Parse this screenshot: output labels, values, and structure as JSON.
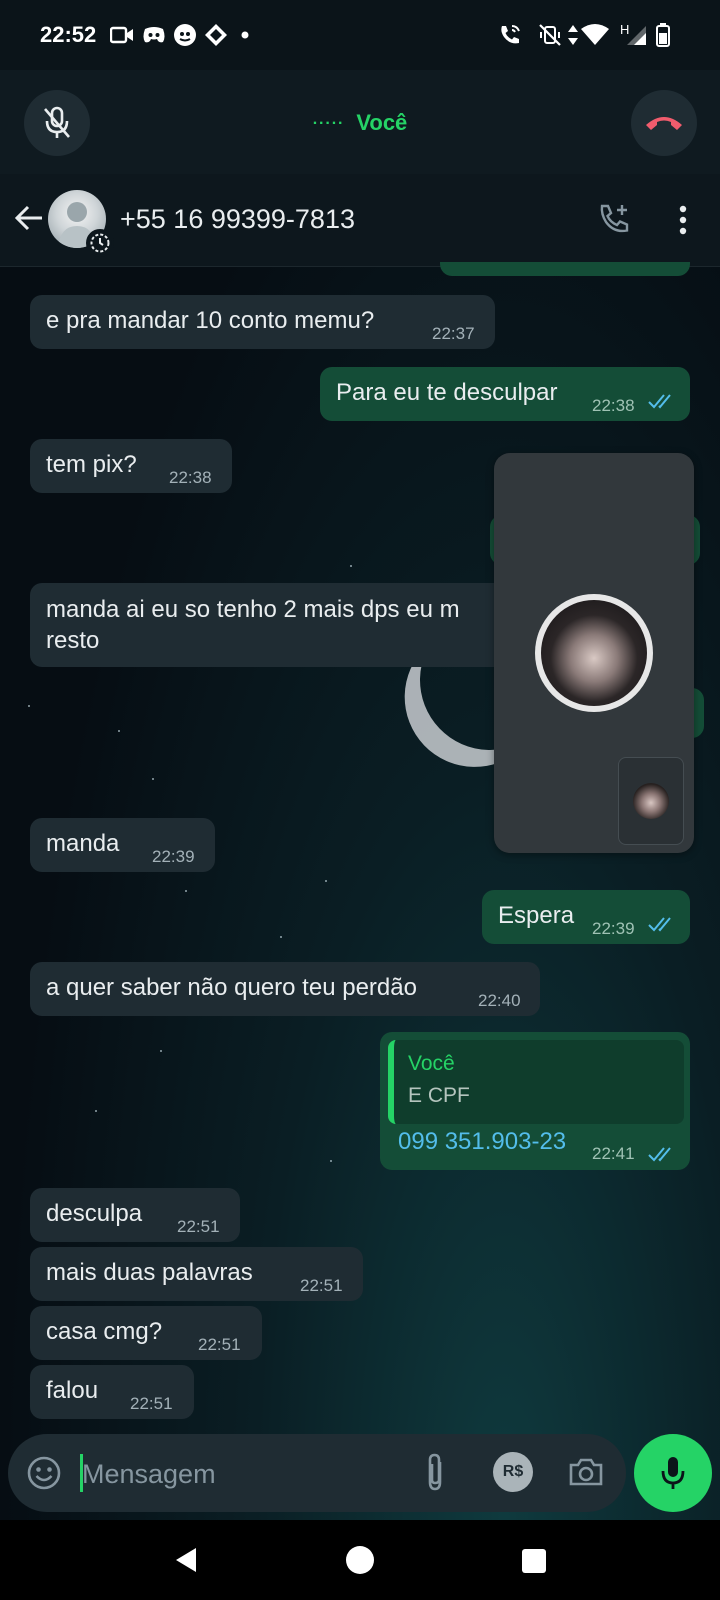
{
  "status_bar": {
    "time": "22:52",
    "left_icons": [
      "video-record-icon",
      "discord-icon",
      "tiktok-icon",
      "app-icon",
      "dot-icon"
    ],
    "right_icons": [
      "wifi-calling-icon",
      "vibrate-off-icon",
      "data-arrows-icon",
      "wifi-icon",
      "signal-icon",
      "battery-icon"
    ],
    "network_label": "H"
  },
  "call_bar": {
    "label": "Você",
    "dots": "·····",
    "end_color": "#f15c6d",
    "accent": "#25d366"
  },
  "header": {
    "contact_name": "+55 16 99399-7813"
  },
  "messages": [
    {
      "dir": "in",
      "text": "e pra mandar 10 conto memu?",
      "time": "22:37"
    },
    {
      "dir": "out",
      "text": "Para eu te desculpar",
      "time": "22:38",
      "read": true
    },
    {
      "dir": "in",
      "text": "tem pix?",
      "time": "22:38"
    },
    {
      "dir": "in",
      "text_line1": "manda ai eu so tenho 2 mais dps eu m",
      "text_line2": "resto"
    },
    {
      "dir": "in",
      "text": "manda",
      "time": "22:39"
    },
    {
      "dir": "out",
      "text": "Espera",
      "time": "22:39",
      "read": true
    },
    {
      "dir": "in",
      "text": "a quer saber não quero teu perdão",
      "time": "22:40"
    },
    {
      "dir": "out",
      "quote_name": "Você",
      "quote_text": "E CPF",
      "text": "099 351.903-23",
      "time": "22:41",
      "read": true
    },
    {
      "dir": "in",
      "text": "desculpa",
      "time": "22:51"
    },
    {
      "dir": "in",
      "text": "mais duas palavras",
      "time": "22:51"
    },
    {
      "dir": "in",
      "text": "casa cmg?",
      "time": "22:51"
    },
    {
      "dir": "in",
      "text": "falou",
      "time": "22:51"
    }
  ],
  "composer": {
    "placeholder": "Mensagem",
    "pay_label": "R$"
  },
  "colors": {
    "incoming_bubble": "#1f2c33",
    "outgoing_bubble": "#144d37",
    "read_tick": "#53bdeb",
    "link": "#53bdeb"
  }
}
